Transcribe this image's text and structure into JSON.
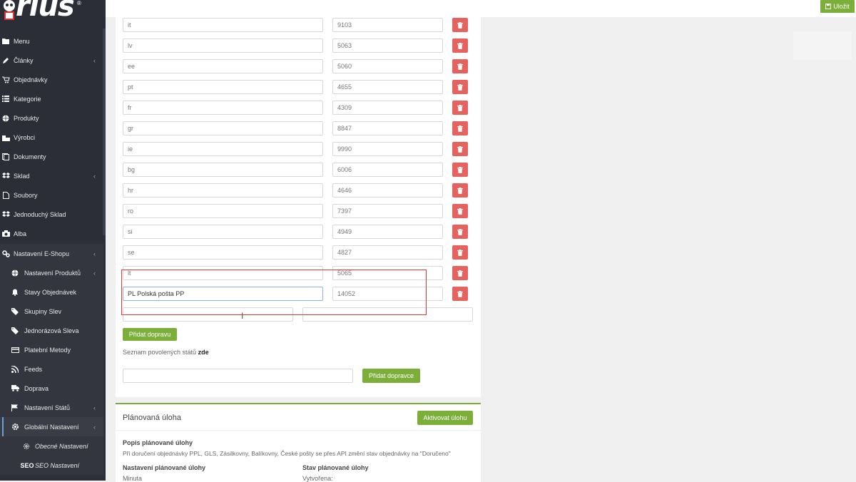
{
  "logo": {
    "text": "rius",
    "reg": "®"
  },
  "sidebar": {
    "items": [
      {
        "label": "Menu",
        "icon": "folder-icon",
        "chevron": ""
      },
      {
        "label": "Články",
        "icon": "pencil-icon",
        "chevron": "‹"
      },
      {
        "label": "Objednávky",
        "icon": "cart-icon",
        "chevron": ""
      },
      {
        "label": "Kategorie",
        "icon": "list-icon",
        "chevron": ""
      },
      {
        "label": "Produkty",
        "icon": "globe-icon",
        "chevron": ""
      },
      {
        "label": "Výrobci",
        "icon": "building-icon",
        "chevron": ""
      },
      {
        "label": "Dokumenty",
        "icon": "document-icon",
        "chevron": ""
      },
      {
        "label": "Sklad",
        "icon": "dropbox-icon",
        "chevron": "‹"
      },
      {
        "label": "Soubory",
        "icon": "file-icon",
        "chevron": ""
      },
      {
        "label": "Jednoduchý Sklad",
        "icon": "dropbox-icon",
        "chevron": ""
      },
      {
        "label": "Alba",
        "icon": "camera-icon",
        "chevron": ""
      },
      {
        "label": "Nastavení E-Shopu",
        "icon": "gears-icon",
        "chevron": "‹"
      },
      {
        "label": "Nastavení Produktů",
        "icon": "globe-icon",
        "chevron": "‹"
      },
      {
        "label": "Stavy Objednávek",
        "icon": "bell-icon",
        "chevron": ""
      },
      {
        "label": "Skupiny Slev",
        "icon": "tag-icon",
        "chevron": ""
      },
      {
        "label": "Jednorázová Sleva",
        "icon": "tags-icon",
        "chevron": ""
      },
      {
        "label": "Platební Metody",
        "icon": "credit-card-icon",
        "chevron": ""
      },
      {
        "label": "Feeds",
        "icon": "rss-icon",
        "chevron": ""
      },
      {
        "label": "Doprava",
        "icon": "truck-icon",
        "chevron": ""
      },
      {
        "label": "Nastavení Států",
        "icon": "flag-icon",
        "chevron": "‹"
      },
      {
        "label": "Globální Nastavení",
        "icon": "gear-icon",
        "chevron": "‹"
      },
      {
        "label": "Obecné Nastavení",
        "icon": "gear-small-icon",
        "chevron": ""
      },
      {
        "label": "SEO Nastavení",
        "icon": "seo-icon",
        "chevron": ""
      }
    ]
  },
  "topbar": {
    "save_label": "Uložit"
  },
  "carriers": [
    {
      "country": "it",
      "id": "9103"
    },
    {
      "country": "lv",
      "id": "5063"
    },
    {
      "country": "ee",
      "id": "5060"
    },
    {
      "country": "pt",
      "id": "4655"
    },
    {
      "country": "fr",
      "id": "4309"
    },
    {
      "country": "gr",
      "id": "8847"
    },
    {
      "country": "ie",
      "id": "9990"
    },
    {
      "country": "bg",
      "id": "6006"
    },
    {
      "country": "hr",
      "id": "4646"
    },
    {
      "country": "ro",
      "id": "7397"
    },
    {
      "country": "si",
      "id": "4949"
    },
    {
      "country": "se",
      "id": "4827"
    },
    {
      "country": "lt",
      "id": "5065"
    },
    {
      "country": "PL Polská pošta PP",
      "id": "14052"
    }
  ],
  "add_shipping_label": "Přidat dopravu",
  "allowed_states_text": "Seznam povolených států",
  "allowed_states_link": "zde",
  "add_carrier_label": "Přidat dopravce",
  "scheduled": {
    "title": "Plánovaná úloha",
    "activate_label": "Aktivovat úlohu",
    "desc_title": "Popis plánované úlohy",
    "desc_text": "Při doručení objednávky PPL, GLS, Zásilkovny, Balíkovny, České pošty se přes API změní stav objednávky na \"Doručeno\"",
    "settings_title": "Nastavení plánované úlohy",
    "settings_value": "Minuta",
    "state_title": "Stav plánované úlohy",
    "state_value": "Vytvořena:"
  },
  "colors": {
    "sidebar": "#2b2e37",
    "accent": "#7cae3a",
    "danger": "#e6625e",
    "highlight": "#e03a2e"
  }
}
